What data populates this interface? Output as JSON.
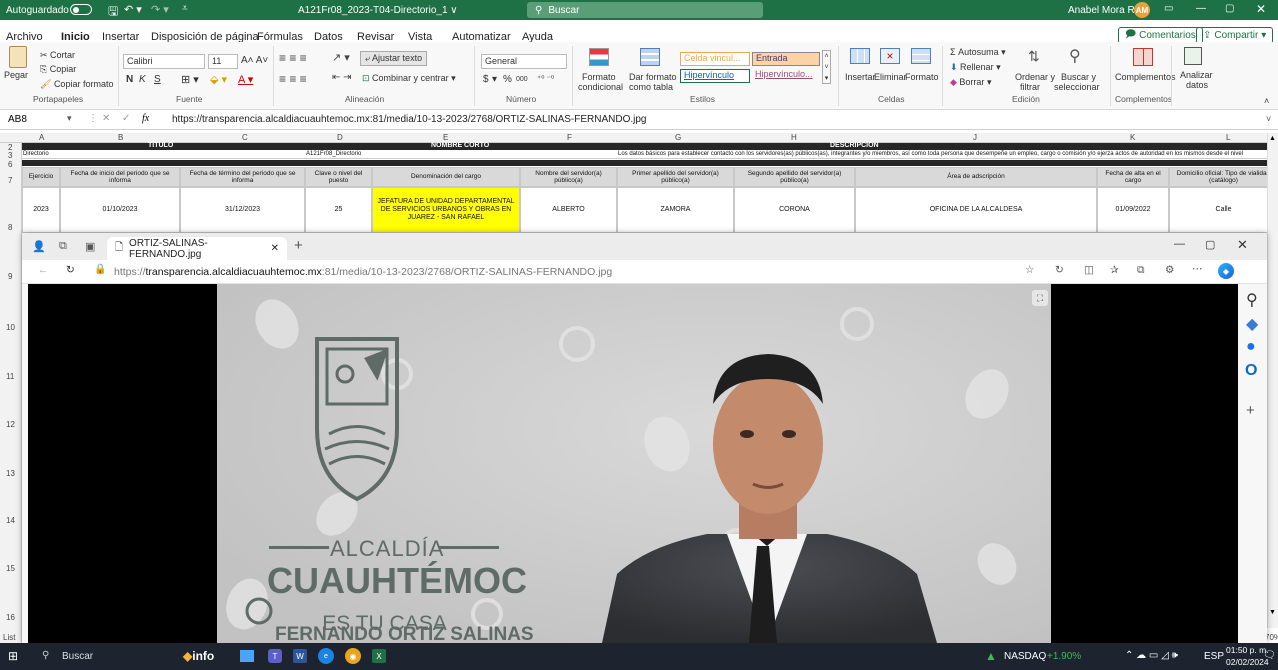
{
  "excel": {
    "autosave_label": "Autoguardado",
    "filename": "A121Fr08_2023-T04-Directorio_1 ∨",
    "search_placeholder": "Buscar",
    "user_name": "Anabel Mora Ruiz",
    "user_initials": "AM",
    "menu_tabs": [
      "Archivo",
      "Inicio",
      "Insertar",
      "Disposición de página",
      "Fórmulas",
      "Datos",
      "Revisar",
      "Vista",
      "Automatizar",
      "Ayuda"
    ],
    "comments_label": "Comentarios",
    "share_label": "Compartir",
    "ribbon": {
      "paste": "Pegar",
      "cut": "Cortar",
      "copy": "Copiar",
      "format_painter": "Copiar formato",
      "clipboard_group": "Portapapeles",
      "font_name": "Calibri",
      "font_size": "11",
      "bold": "N",
      "italic": "K",
      "underline": "S",
      "font_group": "Fuente",
      "wrap_text": "Ajustar texto",
      "merge_center": "Combinar y centrar",
      "alignment_group": "Alineación",
      "number_format": "General",
      "currency": "$",
      "percent": "%",
      "thousands": "000",
      "number_group": "Número",
      "conditional_format_1": "Formato",
      "conditional_format_2": "condicional",
      "format_table_1": "Dar formato",
      "format_table_2": "como tabla",
      "style_cell1": "Celda vincul...",
      "style_cell2": "Entrada",
      "style_cell3": "Hipervínculo",
      "style_cell4": "Hipervínculo...",
      "styles_group": "Estilos",
      "insert": "Insertar",
      "delete": "Eliminar",
      "format": "Formato",
      "cells_group": "Celdas",
      "autosum": "Autosuma",
      "fill": "Rellenar",
      "clear": "Borrar",
      "sort_1": "Ordenar y",
      "sort_2": "filtrar",
      "find_1": "Buscar y",
      "find_2": "seleccionar",
      "editing_group": "Edición",
      "addins": "Complementos",
      "addins_group": "Complementos",
      "analyze_1": "Analizar",
      "analyze_2": "datos"
    },
    "name_box": "AB8",
    "fx": "fx",
    "formula": "https://transparencia.alcaldiacuauhtemoc.mx:81/media/10-13-2023/2768/ORTIZ-SALINAS-FERNANDO.jpg",
    "columns": [
      "A",
      "B",
      "C",
      "D",
      "E",
      "F",
      "G",
      "H",
      "I",
      "J",
      "K",
      "L"
    ],
    "rows": [
      "2",
      "3",
      "6",
      "7",
      "8",
      "9",
      "10",
      "11",
      "12",
      "13",
      "14",
      "15",
      "16"
    ],
    "sheet": {
      "titulo": "TÍTULO",
      "nombre_corto": "NOMBRE CORTO",
      "descripcion": "DESCRIPCIÓN",
      "directorio": "Directorio",
      "code": "A121Fr08_Directorio",
      "desc_text": "Los datos básicos para establecer contacto con los servidores(as) públicos(as), integrantes y/o miembros, así como toda persona que desempeñe un empleo, cargo o comisión y/o ejerza actos de autoridad en los mismos desde el nivel",
      "headers": [
        "Ejercicio",
        "Fecha de inicio del periodo que se informa",
        "Fecha de término del periodo que se informa",
        "Clave o nivel del puesto",
        "Denominación del cargo",
        "Nombre del servidor(a) público(a)",
        "Primer apellido del servidor(a) público(a)",
        "Segundo apellido del servidor(a) público(a)",
        "Área de adscripción",
        "Fecha de alta en el cargo",
        "Domicilio oficial: Tipo de vialidad (catálogo)"
      ],
      "row8": [
        "2023",
        "01/10/2023",
        "31/12/2023",
        "25",
        "JEFATURA DE UNIDAD DEPARTAMENTAL DE SERVICIOS URBANOS Y OBRAS EN JUAREZ - SAN RAFAEL",
        "ALBERTO",
        "ZAMORA",
        "CORONA",
        "OFICINA DE LA ALCALDESA",
        "01/09/2022",
        "Calle"
      ],
      "sheet_tab": "List",
      "zoom": "70%"
    }
  },
  "browser": {
    "tab_title": "ORTIZ-SALINAS-FERNANDO.jpg",
    "url_prefix": "https://",
    "url_host": "transparencia.alcaldiacuauhtemoc.mx",
    "url_path": ":81/media/10-13-2023/2768/ORTIZ-SALINAS-FERNANDO.jpg",
    "image": {
      "logo_line1": "ALCALDÍA",
      "logo_line2": "CUAUHTÉMOC",
      "logo_line3": "ES TU CASA",
      "person_name": "FERNANDO ORTIZ SALINAS",
      "colors": {
        "bg": "#cdcdcd",
        "logo": "#5f6b66"
      }
    }
  },
  "taskbar": {
    "search": "Buscar",
    "info_app": "info",
    "stock": "NASDAQ",
    "stock_change": "+1.90%",
    "lang": "ESP",
    "time": "01:50 p. m.",
    "date": "02/02/2024"
  }
}
